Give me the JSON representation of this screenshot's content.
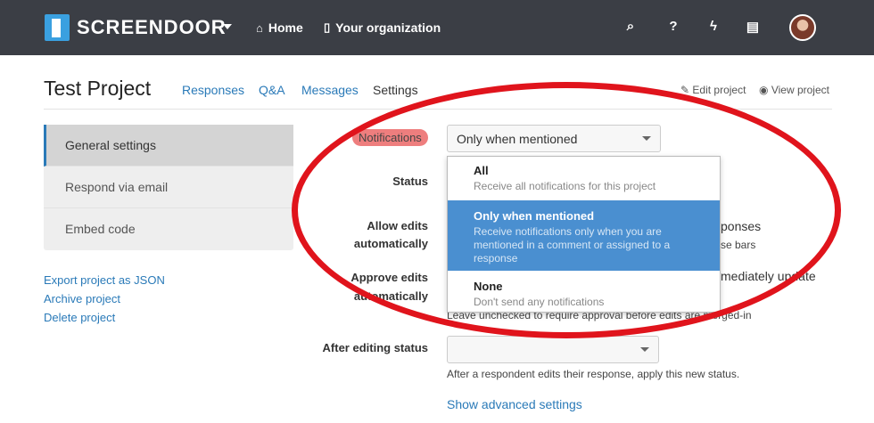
{
  "topbar": {
    "brand": "SCREENDOOR",
    "nav": [
      {
        "icon": "home-icon",
        "glyph": "⌂",
        "label": "Home"
      },
      {
        "icon": "building-icon",
        "glyph": "▯",
        "label": "Your organization"
      }
    ],
    "icons": [
      "search-icon",
      "help-icon",
      "bolt-icon",
      "document-icon"
    ]
  },
  "header": {
    "title": "Test Project",
    "tabs": [
      "Responses",
      "Q&A",
      "Messages",
      "Settings"
    ],
    "active_tab": "Settings",
    "edit_project": "Edit project",
    "view_project": "View project"
  },
  "sidebar": {
    "items": [
      "General settings",
      "Respond via email",
      "Embed code"
    ],
    "active": "General settings",
    "links": [
      "Export project as JSON",
      "Archive project",
      "Delete project"
    ]
  },
  "form": {
    "notifications_label": "Notifications",
    "notifications_value": "Only when mentioned",
    "status_label": "Status",
    "allow_edits_label_1": "Allow edits",
    "allow_edits_label_2": "automatically",
    "allow_edits_partial_1": "ponses",
    "allow_edits_partial_2": "se bars",
    "approve_edits_label_1": "Approve edits",
    "approve_edits_label_2": "automatically",
    "approve_edits_partial": "mediately update",
    "approve_edits_help": "Leave unchecked to require approval before edits are merged-in",
    "after_editing_label": "After editing status",
    "after_editing_value": "",
    "after_editing_help": "After a respondent edits their response, apply this new status.",
    "advanced_link": "Show advanced settings"
  },
  "dropdown": {
    "options": [
      {
        "title": "All",
        "desc": "Receive all notifications for this project"
      },
      {
        "title": "Only when mentioned",
        "desc": "Receive notifications only when you are mentioned in a comment or assigned to a response"
      },
      {
        "title": "None",
        "desc": "Don't send any notifications"
      }
    ],
    "selected": "Only when mentioned"
  },
  "colors": {
    "topbar": "#3b3e45",
    "accent": "#2a7ab8",
    "selected": "#4a8fd0",
    "annotation": "#e0141c"
  }
}
